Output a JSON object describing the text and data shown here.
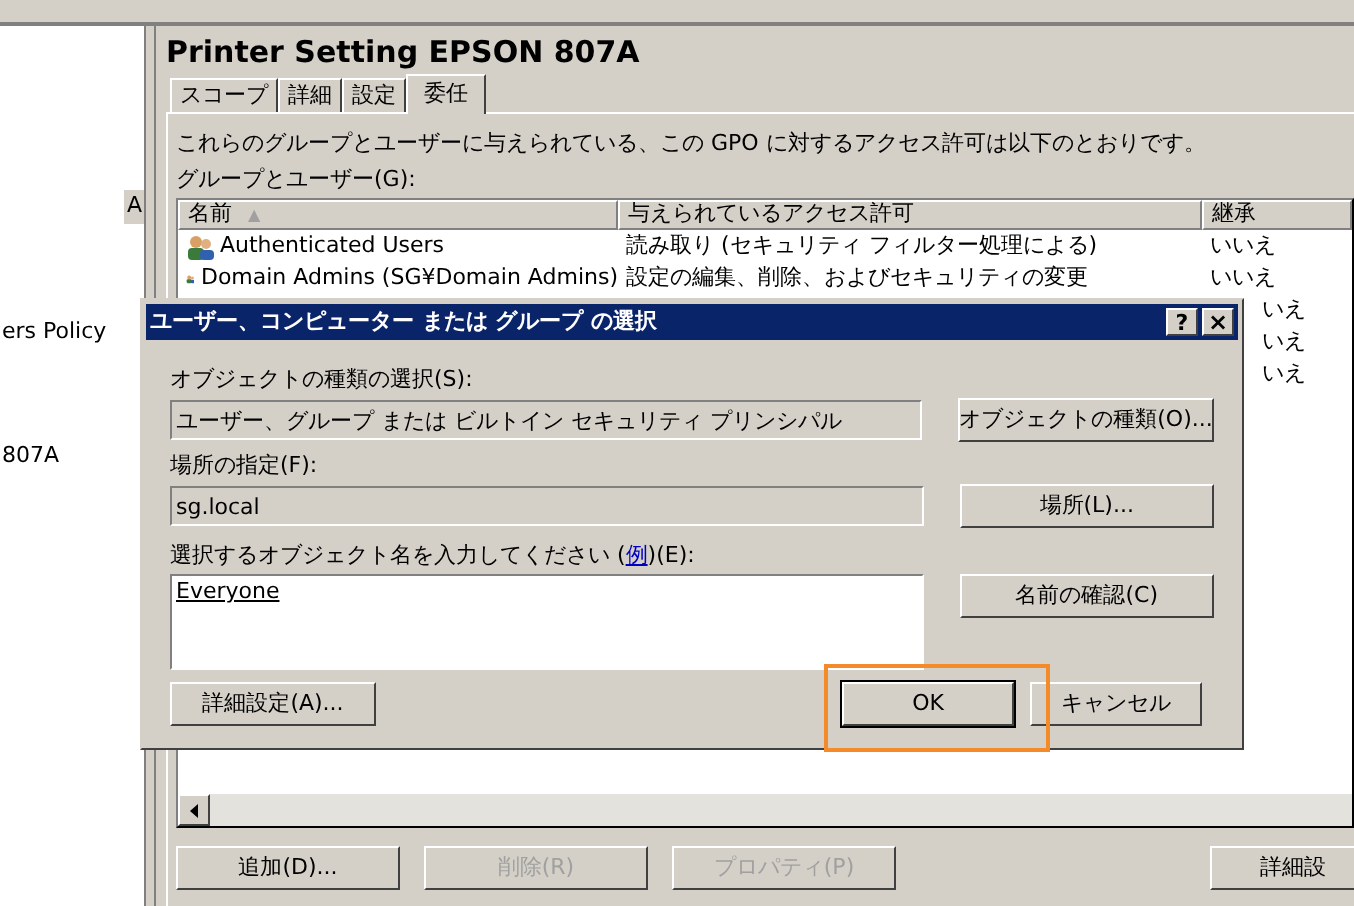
{
  "tree": {
    "items": [
      {
        "label": "A",
        "selected": true
      },
      {
        "label": "ers Policy",
        "selected": false
      },
      {
        "label": "807A",
        "selected": false
      }
    ]
  },
  "panel": {
    "title": "Printer Setting EPSON 807A",
    "tabs": [
      {
        "label": "スコープ",
        "selected": false
      },
      {
        "label": "詳細",
        "selected": false
      },
      {
        "label": "設定",
        "selected": false
      },
      {
        "label": "委任",
        "selected": true
      }
    ],
    "description": "これらのグループとユーザーに与えられている、この GPO に対するアクセス許可は以下のとおりです。",
    "list_label": "グループとユーザー(G):",
    "table": {
      "columns": [
        {
          "label": "名前",
          "sort": "▲"
        },
        {
          "label": "与えられているアクセス許可"
        },
        {
          "label": "継承"
        }
      ],
      "rows": [
        {
          "name": "Authenticated Users",
          "permission": "読み取り (セキュリティ フィルター処理による)",
          "inherited": "いいえ"
        },
        {
          "name": "Domain Admins (SG¥Domain Admins)",
          "permission": "設定の編集、削除、およびセキュリティの変更",
          "inherited": "いいえ"
        },
        {
          "inherited": "いえ"
        },
        {
          "inherited": "いえ"
        },
        {
          "inherited": "いえ"
        }
      ]
    },
    "buttons": [
      {
        "label": "追加(D)...",
        "disabled": false
      },
      {
        "label": "削除(R)",
        "disabled": true
      },
      {
        "label": "プロパティ(P)",
        "disabled": true
      },
      {
        "label": "詳細設",
        "disabled": false
      }
    ]
  },
  "dialog": {
    "title": "ユーザー、コンピューター または グループ の選択",
    "help": "?",
    "close": "×",
    "object_type_label": "オブジェクトの種類の選択(S):",
    "object_type_value": "ユーザー、グループ または ビルトイン セキュリティ プリンシパル",
    "object_type_button": "オブジェクトの種類(O)...",
    "location_label": "場所の指定(F):",
    "location_value": "sg.local",
    "location_button": "場所(L)...",
    "names_label_before": "選択するオブジェクト名を入力してください (",
    "names_label_link": "例",
    "names_label_after": ")(E):",
    "names_value": "Everyone",
    "check_names_button": "名前の確認(C)",
    "advanced_button": "詳細設定(A)...",
    "ok_button": "OK",
    "cancel_button": "キャンセル",
    "ok_highlighted": true
  }
}
